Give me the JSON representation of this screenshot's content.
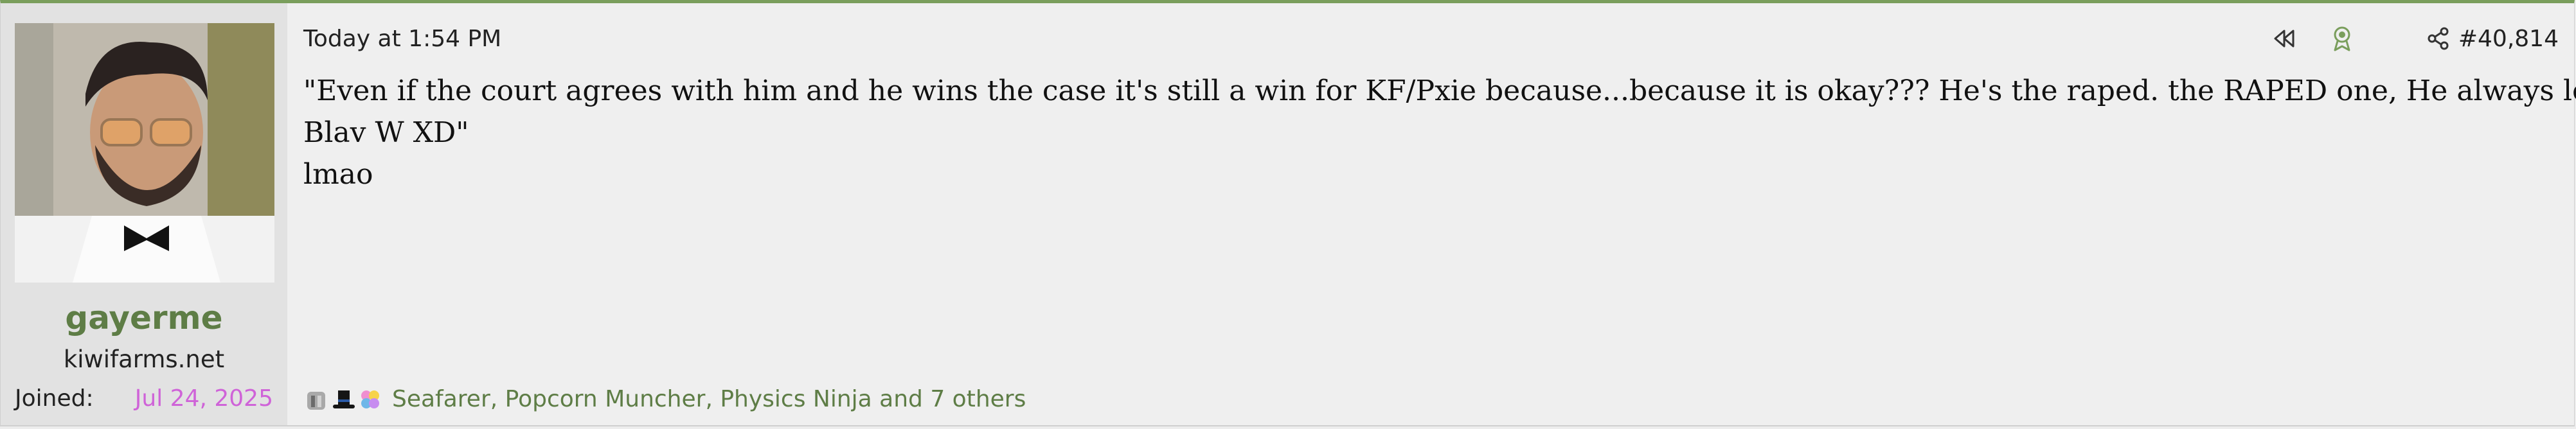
{
  "post": {
    "author": {
      "username": "gayerme",
      "user_title": "kiwifarms.net",
      "joined_label": "Joined:",
      "joined_value": "Jul 24, 2025"
    },
    "timestamp": "Today at 1:54 PM",
    "post_number": "#40,814",
    "body_lines": [
      "\"Even if the court agrees with him and he wins the case it's still a win for KF/Pxie because...because it is okay??? He's the raped. the RAPED one, He always loses.",
      "Blav W XD\"",
      "lmao"
    ],
    "reactions_text": "Seafarer, Popcorn Muncher, Physics Ninja and 7 others",
    "reaction_icons": [
      "seafarer-icon",
      "top-hat-icon",
      "physics-ninja-icon"
    ],
    "action_icons": [
      "rewind-icon",
      "award-icon",
      "share-icon"
    ]
  },
  "colors": {
    "accent": "#7a9e5c",
    "username": "#5e7d46",
    "joined_date": "#cf63d8",
    "user_col_bg": "#e2e2e2",
    "post_bg": "#efefef"
  }
}
